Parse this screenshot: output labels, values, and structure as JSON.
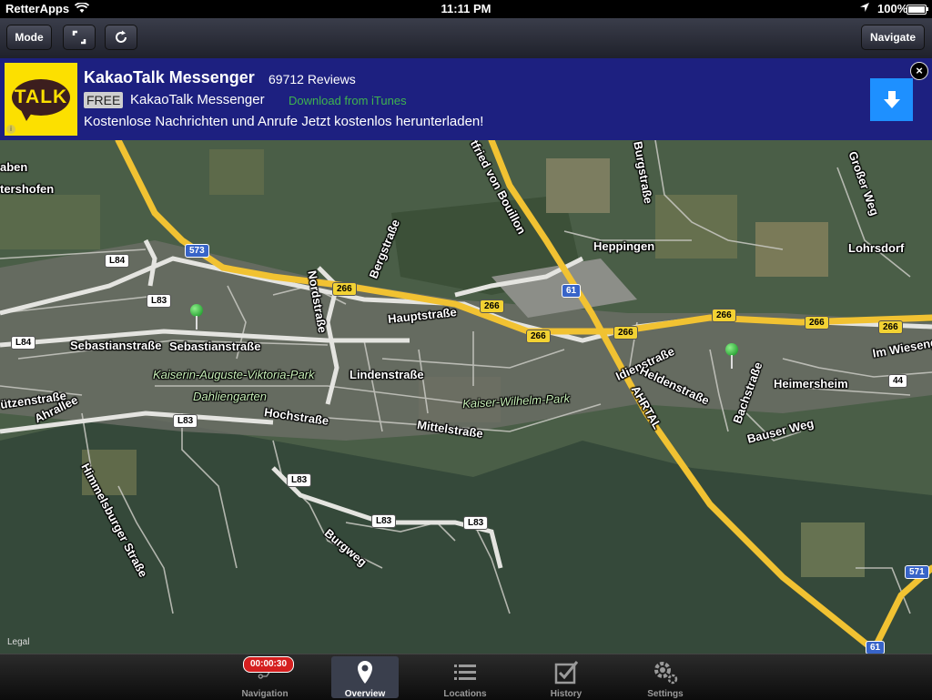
{
  "status_bar": {
    "carrier": "RetterApps",
    "time": "11:11 PM",
    "battery": "100%"
  },
  "toolbar": {
    "mode_label": "Mode",
    "navigate_label": "Navigate"
  },
  "ad": {
    "logo_text": "TALK",
    "title": "KakaoTalk Messenger",
    "reviews": "69712 Reviews",
    "free_badge": "FREE",
    "subtitle": "KakaoTalk Messenger",
    "store_link": "Download from iTunes",
    "description": "Kostenlose Nachrichten und Anrufe Jetzt kostenlos herunterladen!",
    "close_glyph": "×",
    "info_glyph": "i"
  },
  "map": {
    "places": {
      "aben": "aben",
      "tershofen": "tershofen",
      "heppingen": "Heppingen",
      "lohrsdorf": "Lohrsdorf",
      "heimersheim": "Heimersheim",
      "im_wiesengr": "Im Wiesengrund"
    },
    "streets": {
      "bergstrasse": "Bergstraße",
      "nordstrasse": "Nordstraße",
      "hauptstrasse": "Hauptstraße",
      "sebastianstrasse_1": "Sebastianstraße",
      "sebastianstrasse_2": "Sebastianstraße",
      "lindenstrasse": "Lindenstraße",
      "hochstrasse": "Hochstraße",
      "mittelstrasse": "Mittelstraße",
      "utzenstrasse": "ützenstraße",
      "ahrallee": "Ahrallee",
      "himmelsburger": "Himmelsburger Straße",
      "burgweg": "Burgweg",
      "idienstrasse": "Idienstraße",
      "heldenstrasse": "Heldenstraße",
      "bachstrasse": "Bachstraße",
      "bauser_weg": "Bauser Weg",
      "ahrtal": "AHRTAL",
      "gottfried": "tfried von Bouillon",
      "burgstrasse": "Burgstraße",
      "grosser_weg": "Großer Weg"
    },
    "parks": {
      "kaiserin": "Kaiserin-Auguste-Viktoria-Park",
      "dahliengarten": "Dahliengarten",
      "kaiser_wilhelm": "Kaiser-Wilhelm-Park"
    },
    "shields": {
      "s573": "573",
      "l84a": "L84",
      "l84b": "L84",
      "l83a": "L83",
      "l83b": "L83",
      "l83c": "L83",
      "l83d": "L83",
      "l83e": "L83",
      "r266a": "266",
      "r266b": "266",
      "r266c": "266",
      "r266d": "266",
      "r266e": "266",
      "r266f": "266",
      "r266g": "266",
      "a61a": "61",
      "a61b": "61",
      "a571": "571",
      "r44": "44"
    },
    "legal": "Legal"
  },
  "tabbar": {
    "timer": "00:00:30",
    "tabs": [
      {
        "label": "Navigation"
      },
      {
        "label": "Overview"
      },
      {
        "label": "Locations"
      },
      {
        "label": "History"
      },
      {
        "label": "Settings"
      }
    ],
    "active_tab": "Overview"
  },
  "colors": {
    "toolbar": "#2b2e3a",
    "ad_background": "#1d2080",
    "download_button": "#1e90ff",
    "motorway": "#f2c233",
    "pin": "#1aa32a",
    "timer": "#d51f1f"
  }
}
